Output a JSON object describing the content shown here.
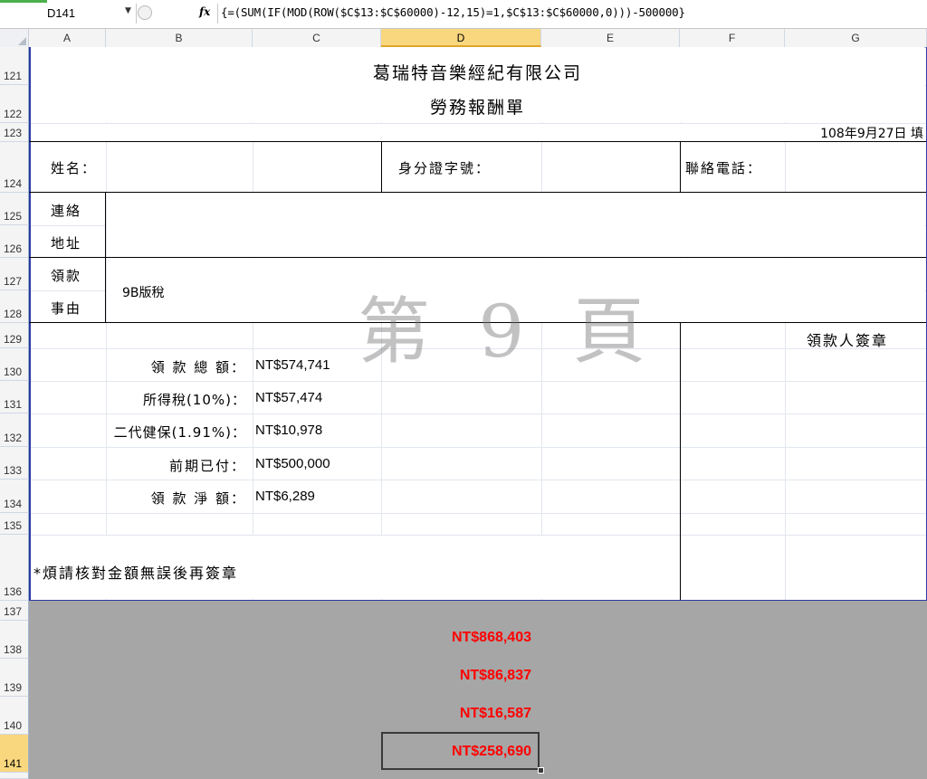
{
  "formula_bar": {
    "name_box": "D141",
    "fx_label": "fx",
    "formula": "{=(SUM(IF(MOD(ROW($C$13:$C$60000)-12,15)=1,$C$13:$C$60000,0)))-500000}"
  },
  "columns": [
    "A",
    "B",
    "C",
    "D",
    "E",
    "F",
    "G"
  ],
  "selected_column": "D",
  "rows": [
    "121",
    "122",
    "123",
    "124",
    "125",
    "126",
    "127",
    "128",
    "129",
    "130",
    "131",
    "132",
    "133",
    "134",
    "135",
    "136",
    "137",
    "138",
    "139",
    "140",
    "141"
  ],
  "selected_row": "141",
  "form": {
    "company": "葛瑞特音樂經紀有限公司",
    "doc_title": "勞務報酬單",
    "fill_date": "108年9月27日 填",
    "name_label": "姓名：",
    "id_label": "身分證字號：",
    "phone_label": "聯絡電話：",
    "address_label_1": "連絡",
    "address_label_2": "地址",
    "reason_label_1": "領款",
    "reason_label_2": "事由",
    "reason_value": "9B版稅",
    "watermark": "第 9 頁",
    "signature_label": "領款人簽章",
    "amounts": [
      {
        "label": "領 款 總 額：",
        "value": "NT$574,741"
      },
      {
        "label": "所得稅(10%)：",
        "value": "NT$57,474"
      },
      {
        "label": "二代健保(1.91%)：",
        "value": "NT$10,978"
      },
      {
        "label": "前期已付：",
        "value": "NT$500,000"
      },
      {
        "label": "領 款 淨 額：",
        "value": "NT$6,289"
      }
    ],
    "note": "*煩請核對金額無誤後再簽章"
  },
  "totals": [
    "NT$868,403",
    "NT$86,837",
    "NT$16,587",
    "NT$258,690"
  ],
  "colors": {
    "grid_border": "#2b3aa0",
    "selection": "#f9d77e",
    "totals_red": "#ff0000",
    "gray_area": "#a6a6a6"
  }
}
